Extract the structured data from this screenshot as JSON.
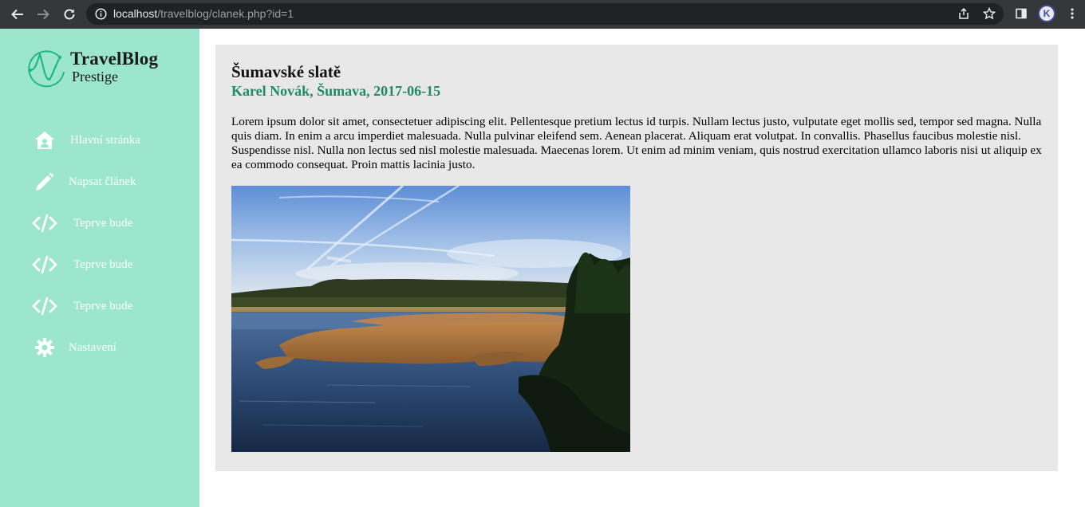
{
  "browser": {
    "url_host": "localhost",
    "url_path": "/travelblog/clanek.php?id=1",
    "profile_initial": "K"
  },
  "sidebar": {
    "logo_title": "TravelBlog",
    "logo_subtitle": "Prestige",
    "items": [
      {
        "label": "Hlavní stránka",
        "icon": "home-icon"
      },
      {
        "label": "Napsat článek",
        "icon": "pencil-icon"
      },
      {
        "label": "Teprve bude",
        "icon": "code-icon"
      },
      {
        "label": "Teprve bude",
        "icon": "code-icon"
      },
      {
        "label": "Teprve bude",
        "icon": "code-icon"
      },
      {
        "label": "Nastavení",
        "icon": "gear-icon"
      }
    ]
  },
  "article": {
    "title": "Šumavské slatě",
    "meta": "Karel Novák, Šumava, 2017-06-15",
    "body": "Lorem ipsum dolor sit amet, consectetuer adipiscing elit. Pellentesque pretium lectus id turpis. Nullam lectus justo, vulputate eget mollis sed, tempor sed magna. Nulla quis diam. In enim a arcu imperdiet malesuada. Nulla pulvinar eleifend sem. Aenean placerat. Aliquam erat volutpat. In convallis. Phasellus faucibus molestie nisl. Suspendisse nisl. Nulla non lectus sed nisl molestie malesuada. Maecenas lorem. Ut enim ad minim veniam, quis nostrud exercitation ullamco laboris nisi ut aliquip ex ea commodo consequat. Proin mattis lacinia justo."
  },
  "colors": {
    "sidebar_bg": "#9be6cc",
    "accent": "#1f8a68",
    "article_bg": "#e8e8e8"
  }
}
